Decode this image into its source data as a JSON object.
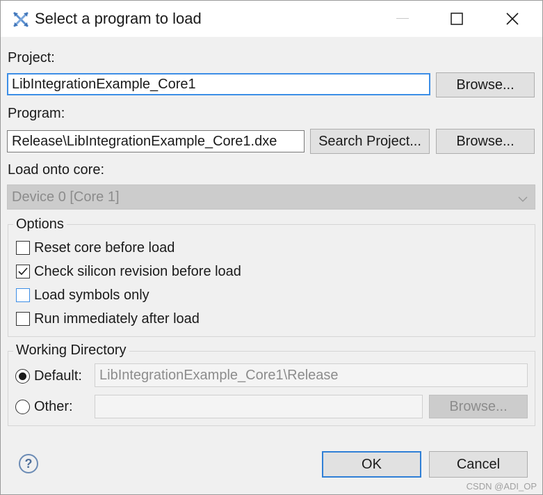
{
  "window": {
    "title": "Select a program to load",
    "icon": "cross-arrows-icon",
    "controls": [
      "minimize-icon",
      "maximize-icon",
      "close-icon"
    ]
  },
  "project": {
    "label": "Project:",
    "value": "LibIntegrationExample_Core1",
    "browse_label": "Browse..."
  },
  "program": {
    "label": "Program:",
    "value": "Release\\LibIntegrationExample_Core1.dxe",
    "search_label": "Search Project...",
    "browse_label": "Browse..."
  },
  "core": {
    "label": "Load onto core:",
    "selected": "Device 0 [Core 1]"
  },
  "options": {
    "title": "Options",
    "items": [
      {
        "label": "Reset core before load",
        "checked": false
      },
      {
        "label": "Check silicon revision before load",
        "checked": true
      },
      {
        "label": "Load symbols only",
        "checked": false
      },
      {
        "label": "Run immediately after load",
        "checked": false
      }
    ]
  },
  "working_directory": {
    "title": "Working Directory",
    "default_label": "Default:",
    "default_value": "LibIntegrationExample_Core1\\Release",
    "other_label": "Other:",
    "other_value": "",
    "browse_label": "Browse...",
    "selected": "default"
  },
  "footer": {
    "ok_label": "OK",
    "cancel_label": "Cancel"
  },
  "watermark": "CSDN @ADI_OP",
  "colors": {
    "focus_border": "#3c8ee6",
    "dialog_bg": "#f0f0f0"
  }
}
